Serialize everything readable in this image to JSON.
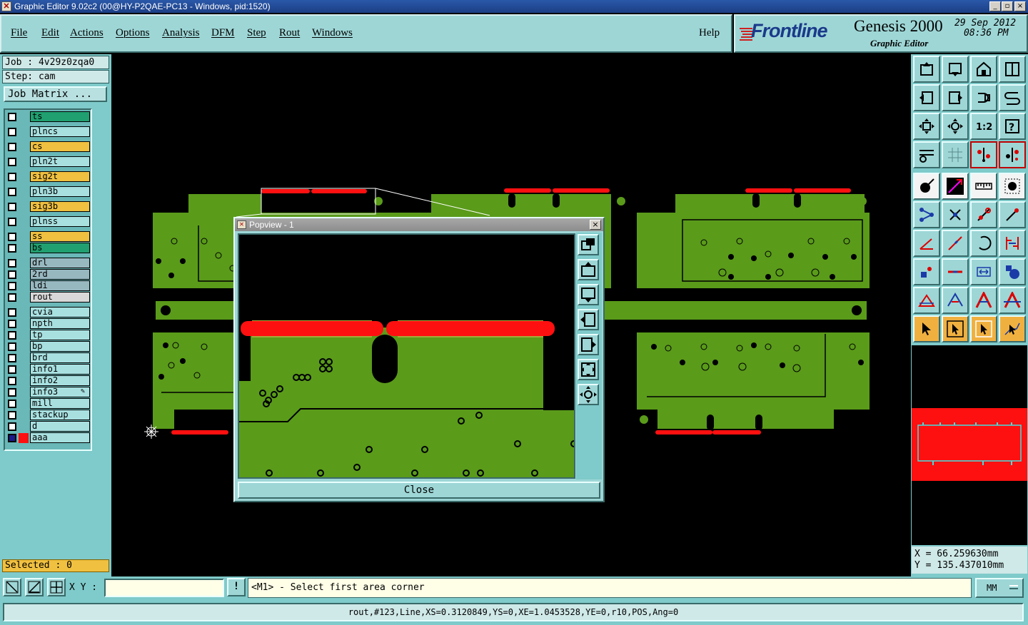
{
  "window": {
    "title": "Graphic Editor 9.02c2 (00@HY-P2QAE-PC13 - Windows, pid:1520)",
    "minimize": "_",
    "maximize": "▫",
    "close": "×"
  },
  "menu": {
    "items": [
      "File",
      "Edit",
      "Actions",
      "Options",
      "Analysis",
      "DFM",
      "Step",
      "Rout",
      "Windows"
    ],
    "help": "Help"
  },
  "brand": {
    "logo": "Frontline",
    "product": "Genesis 2000",
    "subtitle": "Graphic Editor",
    "date": "29 Sep 2012",
    "time": "08:36 PM"
  },
  "job": {
    "job_label": "Job : 4v29z0zqa0",
    "step_label": "Step: cam",
    "matrix_button": "Job Matrix ..."
  },
  "layers": [
    {
      "name": "ts",
      "color": "#20a070"
    },
    {
      "name": "plncs",
      "color": "#a8e0e0"
    },
    {
      "name": "cs",
      "color": "#f0c040"
    },
    {
      "name": "pln2t",
      "color": "#a8e0e0"
    },
    {
      "name": "sig2t",
      "color": "#f0c040"
    },
    {
      "name": "pln3b",
      "color": "#a8e0e0"
    },
    {
      "name": "sig3b",
      "color": "#f0c040"
    },
    {
      "name": "plnss",
      "color": "#a8e0e0"
    },
    {
      "name": "ss",
      "color": "#f0c040"
    },
    {
      "name": "bs",
      "color": "#20a070"
    },
    {
      "name": "drl",
      "color": "#98b8c0"
    },
    {
      "name": "2rd",
      "color": "#98b8c0"
    },
    {
      "name": "ldi",
      "color": "#98b8c0"
    },
    {
      "name": "rout",
      "color": "#d8d8d8"
    },
    {
      "name": "cvia",
      "color": "#a8e0e0"
    },
    {
      "name": "npth",
      "color": "#a8e0e0"
    },
    {
      "name": "tp",
      "color": "#a8e0e0"
    },
    {
      "name": "bp",
      "color": "#a8e0e0"
    },
    {
      "name": "brd",
      "color": "#a8e0e0"
    },
    {
      "name": "info1",
      "color": "#a8e0e0"
    },
    {
      "name": "info2",
      "color": "#a8e0e0"
    },
    {
      "name": "info3",
      "color": "#a8e0e0"
    },
    {
      "name": "mill",
      "color": "#a8e0e0"
    },
    {
      "name": "stackup",
      "color": "#a8e0e0"
    },
    {
      "name": "d",
      "color": "#a8e0e0"
    },
    {
      "name": "aaa",
      "color": "#a8e0e0"
    }
  ],
  "selected_text": "Selected : 0",
  "popview": {
    "title": "Popview - 1",
    "close_button": "Close"
  },
  "coords": {
    "x": "X =  66.259630mm",
    "y": "Y = 135.437010mm"
  },
  "bottom": {
    "xy_label": "X Y :",
    "xy_value": "",
    "prompt": "<M1> - Select first area corner",
    "units": "MM"
  },
  "status_line": "rout,#123,Line,XS=0.3120849,YS=0,XE=1.0453528,YE=0,r10,POS,Ang=0",
  "colors": {
    "board": "#5a9b1a",
    "pad_red": "#ff1010",
    "panel": "#7fcaca",
    "menu": "#9ed6d6",
    "active_layer": "#f0c040"
  }
}
